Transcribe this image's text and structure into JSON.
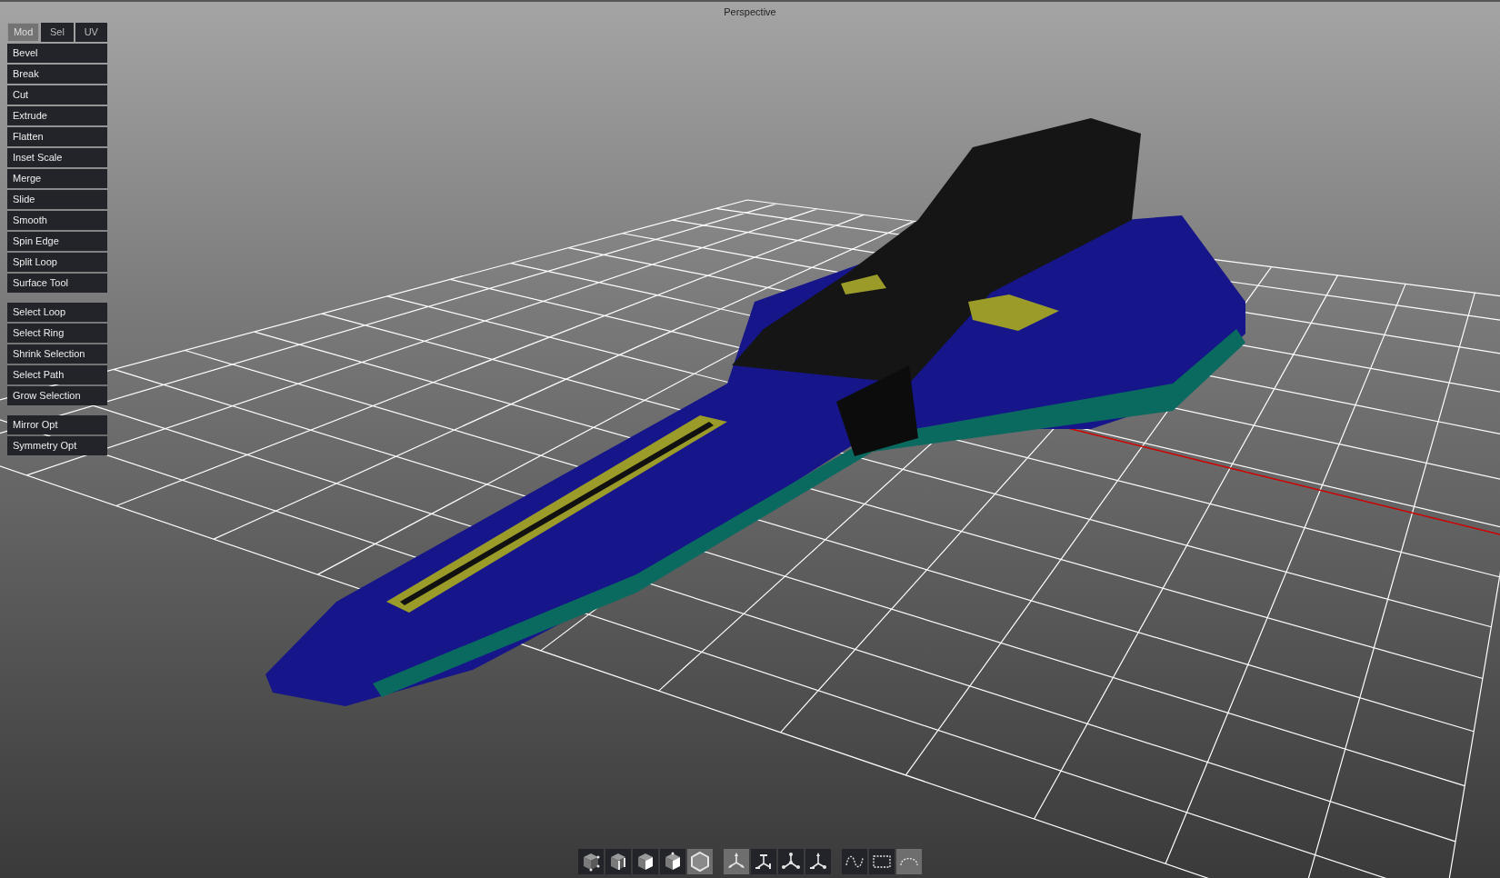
{
  "viewport": {
    "title": "Perspective"
  },
  "tabs": [
    {
      "label": "Mod",
      "selected": true
    },
    {
      "label": "Sel",
      "selected": false
    },
    {
      "label": "UV",
      "selected": false
    }
  ],
  "tool_groups": [
    {
      "buttons": [
        "Bevel",
        "Break",
        "Cut",
        "Extrude",
        "Flatten",
        "Inset Scale",
        "Merge",
        "Slide",
        "Smooth",
        "Spin Edge",
        "Split Loop",
        "Surface Tool"
      ]
    },
    {
      "buttons": [
        "Select Loop",
        "Select Ring",
        "Shrink Selection",
        "Select Path",
        "Grow Selection"
      ]
    },
    {
      "buttons": [
        "Mirror Opt",
        "Symmetry Opt"
      ]
    }
  ],
  "toolbar": [
    [
      {
        "kind": "vertex",
        "selected": false
      },
      {
        "kind": "edge",
        "selected": false
      },
      {
        "kind": "face",
        "selected": false
      },
      {
        "kind": "element",
        "selected": false
      },
      {
        "kind": "object",
        "selected": true
      }
    ],
    [
      {
        "kind": "move",
        "selected": true
      },
      {
        "kind": "rotate",
        "selected": false
      },
      {
        "kind": "scale",
        "selected": false
      },
      {
        "kind": "universal",
        "selected": false
      }
    ],
    [
      {
        "kind": "paint",
        "selected": false
      },
      {
        "kind": "rectangle",
        "selected": false
      },
      {
        "kind": "lasso",
        "selected": true
      }
    ]
  ]
}
